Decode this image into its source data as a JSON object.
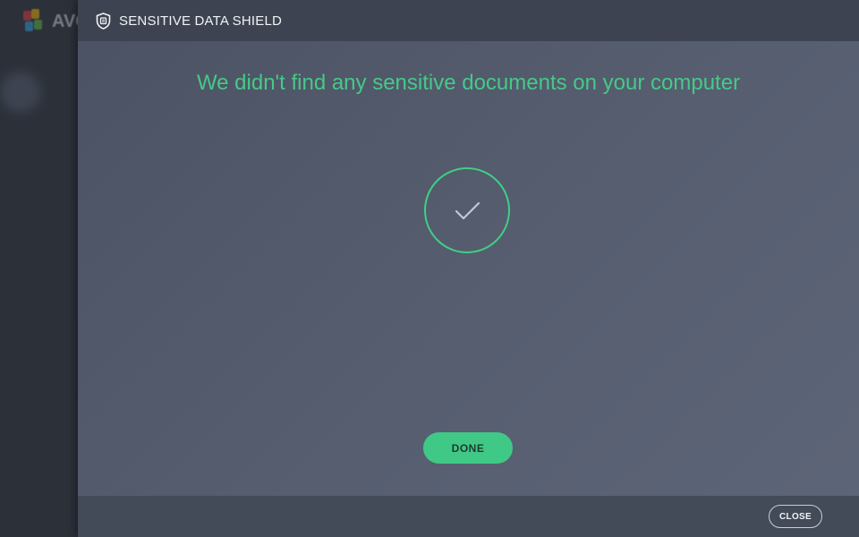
{
  "app": {
    "logo_text": "AVG",
    "logo_colors": [
      "#e03a3e",
      "#f7b500",
      "#33a4de",
      "#5fbb46"
    ]
  },
  "dialog": {
    "title": "SENSITIVE DATA SHIELD",
    "title_icon": "shield-icon",
    "headline": "We didn't find any sensitive documents on your computer",
    "result_icon": "checkmark-icon",
    "done_label": "DONE",
    "close_label": "CLOSE"
  },
  "colors": {
    "accent_green": "#40c986",
    "headline_green": "#46c987",
    "header_bg": "#3d4350",
    "footer_bg": "#434a58"
  }
}
